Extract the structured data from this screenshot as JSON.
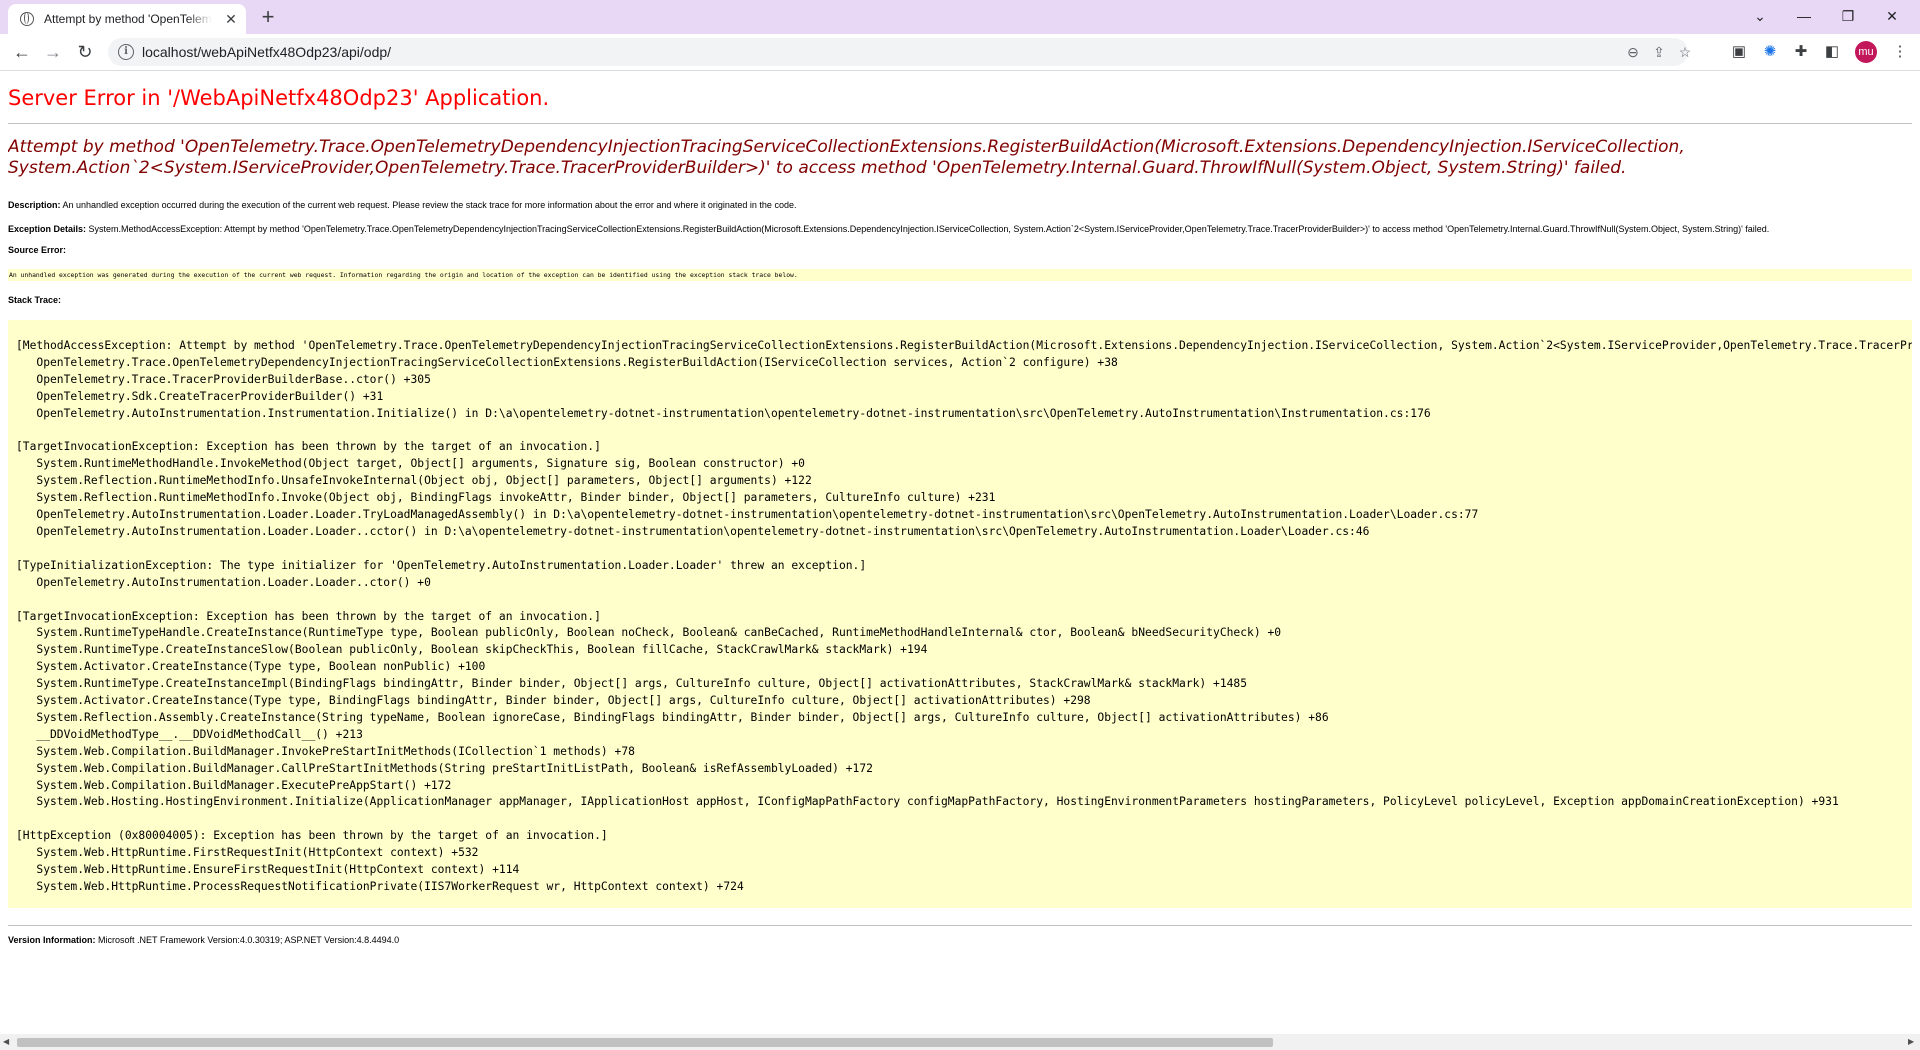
{
  "browser": {
    "tab_title": "Attempt by method 'OpenTelemetry.Trace.OpenTelemetryDependencyInjectionTracingServiceCollectionExtensions.RegisterBuildAction",
    "url": "localhost/webApiNetfx48Odp23/api/odp/",
    "avatar_initials": "mu",
    "icons": {
      "favicon": "globe-icon",
      "close": "close-icon",
      "new_tab": "plus-icon",
      "back": "back-arrow-icon",
      "forward": "forward-arrow-icon",
      "reload": "reload-icon",
      "site_info": "info-icon",
      "zoom": "zoom-icon",
      "share": "share-icon",
      "bookmark": "star-icon",
      "extensions": "puzzle-icon",
      "side_panel": "side-panel-icon",
      "menu": "kebab-menu-icon"
    }
  },
  "page": {
    "heading": "Server Error in '/WebApiNetfx48Odp23' Application.",
    "error_message": "Attempt by method 'OpenTelemetry.Trace.OpenTelemetryDependencyInjectionTracingServiceCollectionExtensions.RegisterBuildAction(Microsoft.Extensions.DependencyInjection.IServiceCollection, System.Action`2<System.IServiceProvider,OpenTelemetry.Trace.TracerProviderBuilder>)' to access method 'OpenTelemetry.Internal.Guard.ThrowIfNull(System.Object, System.String)' failed.",
    "description_label": "Description:",
    "description_text": "An unhandled exception occurred during the execution of the current web request. Please review the stack trace for more information about the error and where it originated in the code.",
    "exception_label": "Exception Details:",
    "exception_text": "System.MethodAccessException: Attempt by method 'OpenTelemetry.Trace.OpenTelemetryDependencyInjectionTracingServiceCollectionExtensions.RegisterBuildAction(Microsoft.Extensions.DependencyInjection.IServiceCollection, System.Action`2<System.IServiceProvider,OpenTelemetry.Trace.TracerProviderBuilder>)' to access method 'OpenTelemetry.Internal.Guard.ThrowIfNull(System.Object, System.String)' failed.",
    "source_error_label": "Source Error:",
    "source_error_text": "An unhandled exception was generated during the execution of the current web request. Information regarding the origin and location of the exception can be identified using the exception stack trace below.",
    "stack_trace_label": "Stack Trace:",
    "stack_trace": "[MethodAccessException: Attempt by method 'OpenTelemetry.Trace.OpenTelemetryDependencyInjectionTracingServiceCollectionExtensions.RegisterBuildAction(Microsoft.Extensions.DependencyInjection.IServiceCollection, System.Action`2<System.IServiceProvider,OpenTelemetry.Trace.TracerProviderBuilder>)' to access method 'OpenTelemetry.Internal.Guard.ThrowIfNull(System.Object, System.String)' failed.]\n   OpenTelemetry.Trace.OpenTelemetryDependencyInjectionTracingServiceCollectionExtensions.RegisterBuildAction(IServiceCollection services, Action`2 configure) +38\n   OpenTelemetry.Trace.TracerProviderBuilderBase..ctor() +305\n   OpenTelemetry.Sdk.CreateTracerProviderBuilder() +31\n   OpenTelemetry.AutoInstrumentation.Instrumentation.Initialize() in D:\\a\\opentelemetry-dotnet-instrumentation\\opentelemetry-dotnet-instrumentation\\src\\OpenTelemetry.AutoInstrumentation\\Instrumentation.cs:176\n\n[TargetInvocationException: Exception has been thrown by the target of an invocation.]\n   System.RuntimeMethodHandle.InvokeMethod(Object target, Object[] arguments, Signature sig, Boolean constructor) +0\n   System.Reflection.RuntimeMethodInfo.UnsafeInvokeInternal(Object obj, Object[] parameters, Object[] arguments) +122\n   System.Reflection.RuntimeMethodInfo.Invoke(Object obj, BindingFlags invokeAttr, Binder binder, Object[] parameters, CultureInfo culture) +231\n   OpenTelemetry.AutoInstrumentation.Loader.Loader.TryLoadManagedAssembly() in D:\\a\\opentelemetry-dotnet-instrumentation\\opentelemetry-dotnet-instrumentation\\src\\OpenTelemetry.AutoInstrumentation.Loader\\Loader.cs:77\n   OpenTelemetry.AutoInstrumentation.Loader.Loader..cctor() in D:\\a\\opentelemetry-dotnet-instrumentation\\opentelemetry-dotnet-instrumentation\\src\\OpenTelemetry.AutoInstrumentation.Loader\\Loader.cs:46\n\n[TypeInitializationException: The type initializer for 'OpenTelemetry.AutoInstrumentation.Loader.Loader' threw an exception.]\n   OpenTelemetry.AutoInstrumentation.Loader.Loader..ctor() +0\n\n[TargetInvocationException: Exception has been thrown by the target of an invocation.]\n   System.RuntimeTypeHandle.CreateInstance(RuntimeType type, Boolean publicOnly, Boolean noCheck, Boolean& canBeCached, RuntimeMethodHandleInternal& ctor, Boolean& bNeedSecurityCheck) +0\n   System.RuntimeType.CreateInstanceSlow(Boolean publicOnly, Boolean skipCheckThis, Boolean fillCache, StackCrawlMark& stackMark) +194\n   System.Activator.CreateInstance(Type type, Boolean nonPublic) +100\n   System.RuntimeType.CreateInstanceImpl(BindingFlags bindingAttr, Binder binder, Object[] args, CultureInfo culture, Object[] activationAttributes, StackCrawlMark& stackMark) +1485\n   System.Activator.CreateInstance(Type type, BindingFlags bindingAttr, Binder binder, Object[] args, CultureInfo culture, Object[] activationAttributes) +298\n   System.Reflection.Assembly.CreateInstance(String typeName, Boolean ignoreCase, BindingFlags bindingAttr, Binder binder, Object[] args, CultureInfo culture, Object[] activationAttributes) +86\n   __DDVoidMethodType__.__DDVoidMethodCall__() +213\n   System.Web.Compilation.BuildManager.InvokePreStartInitMethods(ICollection`1 methods) +78\n   System.Web.Compilation.BuildManager.CallPreStartInitMethods(String preStartInitListPath, Boolean& isRefAssemblyLoaded) +172\n   System.Web.Compilation.BuildManager.ExecutePreAppStart() +172\n   System.Web.Hosting.HostingEnvironment.Initialize(ApplicationManager appManager, IApplicationHost appHost, IConfigMapPathFactory configMapPathFactory, HostingEnvironmentParameters hostingParameters, PolicyLevel policyLevel, Exception appDomainCreationException) +931\n\n[HttpException (0x80004005): Exception has been thrown by the target of an invocation.]\n   System.Web.HttpRuntime.FirstRequestInit(HttpContext context) +532\n   System.Web.HttpRuntime.EnsureFirstRequestInit(HttpContext context) +114\n   System.Web.HttpRuntime.ProcessRequestNotificationPrivate(IIS7WorkerRequest wr, HttpContext context) +724",
    "version_label": "Version Information:",
    "version_text": "Microsoft .NET Framework Version:4.0.30319; ASP.NET Version:4.8.4494.0"
  },
  "colors": {
    "tabstrip": "#e8d8f6",
    "heading": "#ff0000",
    "error_message": "#800000",
    "code_background": "#ffffcc"
  }
}
